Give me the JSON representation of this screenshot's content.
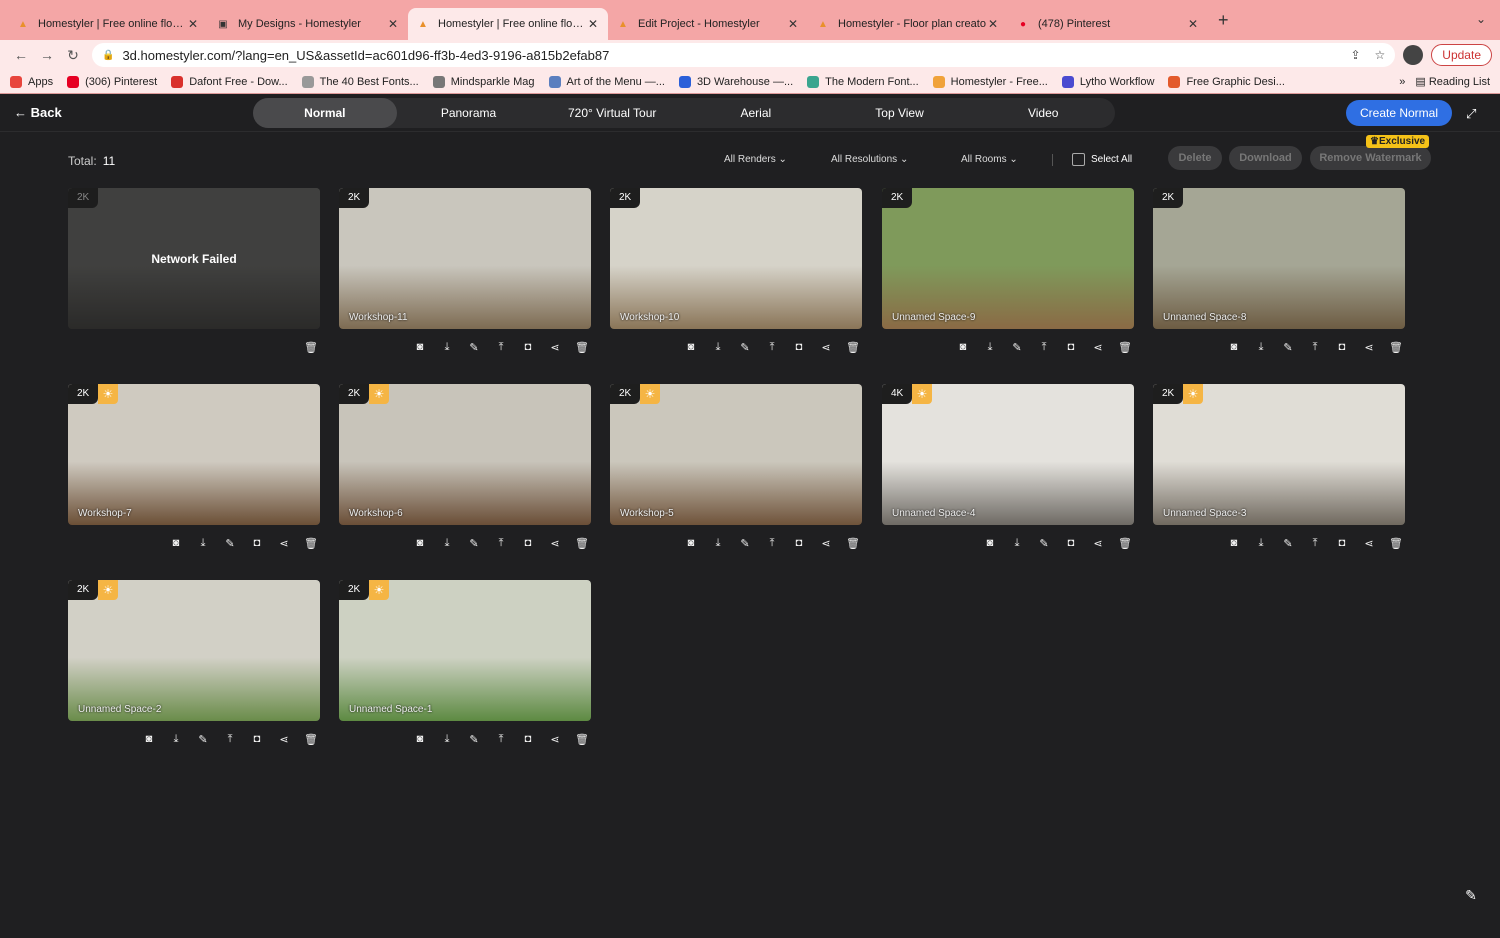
{
  "browser": {
    "tabs": [
      {
        "title": "Homestyler | Free online floor p",
        "active": false,
        "icon": "homestyler-icon"
      },
      {
        "title": "My Designs - Homestyler",
        "active": false,
        "icon": "folder-icon"
      },
      {
        "title": "Homestyler | Free online floor p",
        "active": true,
        "icon": "homestyler-icon"
      },
      {
        "title": "Edit Project - Homestyler",
        "active": false,
        "icon": "homestyler-icon"
      },
      {
        "title": "Homestyler - Floor plan creato",
        "active": false,
        "icon": "homestyler-icon"
      },
      {
        "title": "(478) Pinterest",
        "active": false,
        "icon": "pinterest-icon"
      }
    ],
    "url": "3d.homestyler.com/?lang=en_US&assetId=ac601d96-ff3b-4ed3-9196-a815b2efab87",
    "update_label": "Update",
    "bookmarks": [
      {
        "label": "Apps",
        "color": "#e8453c"
      },
      {
        "label": "(306) Pinterest",
        "color": "#e60023"
      },
      {
        "label": "Dafont Free - Dow...",
        "color": "#d9302c"
      },
      {
        "label": "The 40 Best Fonts...",
        "color": "#999999"
      },
      {
        "label": "Mindsparkle Mag",
        "color": "#777777"
      },
      {
        "label": "Art of the Menu —...",
        "color": "#5b7fbf"
      },
      {
        "label": "3D Warehouse —...",
        "color": "#2b5fd9"
      },
      {
        "label": "The Modern Font...",
        "color": "#3aa58f"
      },
      {
        "label": "Homestyler - Free...",
        "color": "#f0a23a"
      },
      {
        "label": "Lytho Workflow",
        "color": "#4a4ad0"
      },
      {
        "label": "Free Graphic Desi...",
        "color": "#e35a2b"
      }
    ],
    "more_label": "»",
    "reading_list": "Reading List"
  },
  "header": {
    "back_label": "Back",
    "modes": [
      "Normal",
      "Panorama",
      "720° Virtual Tour",
      "Aerial",
      "Top View",
      "Video"
    ],
    "active_mode": "Normal",
    "create_label": "Create Normal"
  },
  "toolbar": {
    "total_label": "Total:",
    "total_value": "11",
    "filters": [
      "All Renders",
      "All Resolutions",
      "All Rooms"
    ],
    "select_all": "Select All",
    "delete": "Delete",
    "download": "Download",
    "remove_watermark": "Remove Watermark",
    "exclusive": "Exclusive"
  },
  "renders": [
    {
      "res": "2K",
      "name": "",
      "failed": true,
      "failed_text": "Network Failed",
      "sun": false
    },
    {
      "res": "2K",
      "name": "Workshop-11",
      "failed": false,
      "sun": false
    },
    {
      "res": "2K",
      "name": "Workshop-10",
      "failed": false,
      "sun": false
    },
    {
      "res": "2K",
      "name": "Unnamed Space-9",
      "failed": false,
      "sun": false
    },
    {
      "res": "2K",
      "name": "Unnamed Space-8",
      "failed": false,
      "sun": false
    },
    {
      "res": "2K",
      "name": "Workshop-7",
      "failed": false,
      "sun": true
    },
    {
      "res": "2K",
      "name": "Workshop-6",
      "failed": false,
      "sun": true
    },
    {
      "res": "2K",
      "name": "Workshop-5",
      "failed": false,
      "sun": true
    },
    {
      "res": "4K",
      "name": "Unnamed Space-4",
      "failed": false,
      "sun": true
    },
    {
      "res": "2K",
      "name": "Unnamed Space-3",
      "failed": false,
      "sun": true
    },
    {
      "res": "2K",
      "name": "Unnamed Space-2",
      "failed": false,
      "sun": true
    },
    {
      "res": "2K",
      "name": "Unnamed Space-1",
      "failed": false,
      "sun": true
    }
  ],
  "action_icons": [
    "retouch-icon",
    "download-icon",
    "edit-icon",
    "upload-icon",
    "save-icon",
    "share-icon",
    "delete-icon"
  ]
}
